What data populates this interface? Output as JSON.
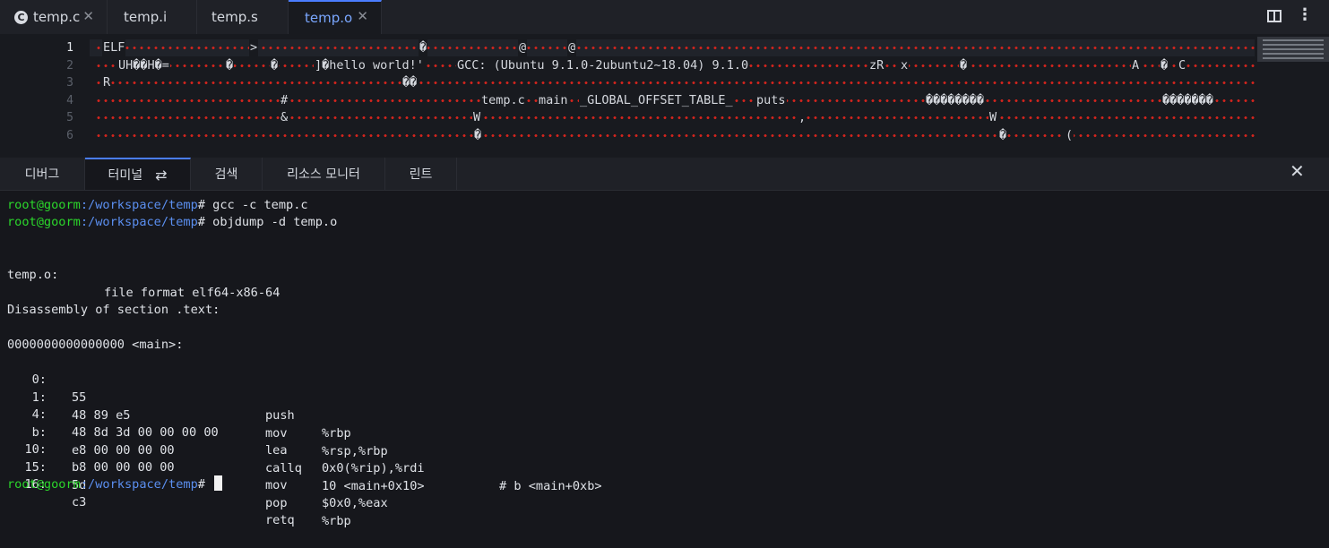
{
  "tabs": [
    {
      "label": "temp.c",
      "icon": "c-file-icon",
      "closable": true,
      "active": false
    },
    {
      "label": "temp.i",
      "closable": false,
      "active": false
    },
    {
      "label": "temp.s",
      "closable": false,
      "active": false
    },
    {
      "label": "temp.o",
      "closable": true,
      "active": true
    }
  ],
  "editor": {
    "line_numbers": [
      "1",
      "2",
      "3",
      "4",
      "5",
      "6"
    ],
    "lines": [
      [
        "ELF",
        ">",
        "�",
        "@",
        "@"
      ],
      [
        "UH��H�=",
        "�",
        "�",
        "]�hello world!'",
        "GCC: (Ubuntu 9.1.0-2ubuntu2~18.04) 9.1.0",
        "zR",
        "x",
        "�",
        "A",
        "�",
        "C"
      ],
      [
        "R",
        "��"
      ],
      [
        "#",
        "temp.c",
        "main",
        "_GLOBAL_OFFSET_TABLE_",
        "puts",
        "��������",
        "�������"
      ],
      [
        "&",
        "W",
        ",",
        "W"
      ],
      [
        "�",
        "�",
        "("
      ]
    ]
  },
  "panel_tabs": [
    {
      "label": "디버그",
      "active": false
    },
    {
      "label": "터미널",
      "active": true,
      "icon": "sync-icon"
    },
    {
      "label": "검색",
      "active": false
    },
    {
      "label": "리소스 모니터",
      "active": false
    },
    {
      "label": "린트",
      "active": false
    }
  ],
  "panel_close_glyph": "✕",
  "terminal": {
    "prompt_user": "root@goorm",
    "prompt_path": ":/workspace/temp",
    "prompt_suffix": "#",
    "commands": [
      "gcc -c temp.c",
      "objdump -d temp.o"
    ],
    "file_name": "temp.o:",
    "file_format": "file format elf64-x86-64",
    "section_header": "Disassembly of section .text:",
    "symbol_header": "0000000000000000 <main>:",
    "disassembly": [
      {
        "addr": "0:",
        "bytes": "55",
        "mnemonic": "push",
        "operands": "%rbp",
        "comment": ""
      },
      {
        "addr": "1:",
        "bytes": "48 89 e5",
        "mnemonic": "mov",
        "operands": "%rsp,%rbp",
        "comment": ""
      },
      {
        "addr": "4:",
        "bytes": "48 8d 3d 00 00 00 00",
        "mnemonic": "lea",
        "operands": "0x0(%rip),%rdi",
        "comment": "# b <main+0xb>"
      },
      {
        "addr": "b:",
        "bytes": "e8 00 00 00 00",
        "mnemonic": "callq",
        "operands": "10 <main+0x10>",
        "comment": ""
      },
      {
        "addr": "10:",
        "bytes": "b8 00 00 00 00",
        "mnemonic": "mov",
        "operands": "$0x0,%eax",
        "comment": ""
      },
      {
        "addr": "15:",
        "bytes": "5d",
        "mnemonic": "pop",
        "operands": "%rbp",
        "comment": ""
      },
      {
        "addr": "16:",
        "bytes": "c3",
        "mnemonic": "retq",
        "operands": "",
        "comment": ""
      }
    ]
  },
  "colors": {
    "prompt_user": "#2bd72b",
    "prompt_path": "#5b8ff0",
    "accent": "#4a7dff",
    "null_dot": "#d4241d"
  }
}
